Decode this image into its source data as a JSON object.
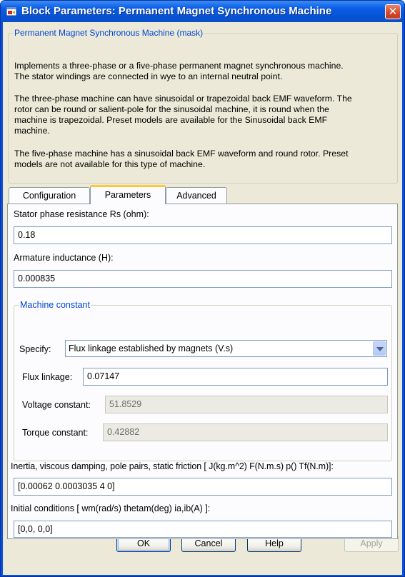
{
  "window": {
    "title": "Block Parameters: Permanent Magnet Synchronous Machine",
    "close_glyph": "✕"
  },
  "mask": {
    "legend": "Permanent Magnet Synchronous Machine (mask)",
    "para1_line1": "Implements a three-phase or a five-phase permanent magnet synchronous machine.",
    "para1_line2": "The stator windings are connected in wye to an internal neutral point.",
    "para2_line1": "The three-phase machine can have sinusoidal or trapezoidal back EMF waveform. The",
    "para2_line2": "rotor can be round or salient-pole for the sinusoidal machine, it is round when the",
    "para2_line3": "machine is trapezoidal. Preset models are available for the Sinusoidal back EMF",
    "para2_line4": "machine.",
    "para3_line1": "The five-phase machine has a sinusoidal back EMF waveform and round rotor. Preset",
    "para3_line2": "models are not available for this type of machine."
  },
  "tabs": [
    {
      "label": "Configuration"
    },
    {
      "label": "Parameters"
    },
    {
      "label": "Advanced"
    }
  ],
  "params": {
    "rs_label": "Stator phase resistance Rs (ohm):",
    "rs_value": "0.18",
    "l_label": "Armature inductance (H):",
    "l_value": "0.000835",
    "mc_legend": "Machine constant",
    "specify_label": "Specify:",
    "specify_value": "Flux linkage established by magnets (V.s)",
    "flux_label": "Flux linkage:",
    "flux_value": "0.07147",
    "voltage_label": "Voltage constant:",
    "voltage_value": "51.8529",
    "torque_label": "Torque constant:",
    "torque_value": "0.42882",
    "inertia_label": "Inertia, viscous damping, pole pairs, static friction [ J(kg.m^2)  F(N.m.s)  p()  Tf(N.m)]:",
    "inertia_value": "[0.00062 0.0003035 4 0]",
    "init_label": "Initial conditions  [ wm(rad/s)  thetam(deg)  ia,ib(A) ]:",
    "init_value": "[0,0, 0,0]"
  },
  "buttons": {
    "ok": "OK",
    "cancel": "Cancel",
    "help": "Help",
    "apply": "Apply"
  },
  "colors": {
    "title_bar": "#0a5ee6",
    "client_bg": "#ece9d8",
    "legend_text": "#0046d5",
    "active_tab_highlight": "#ffc83c",
    "close_button": "#d5462a"
  }
}
